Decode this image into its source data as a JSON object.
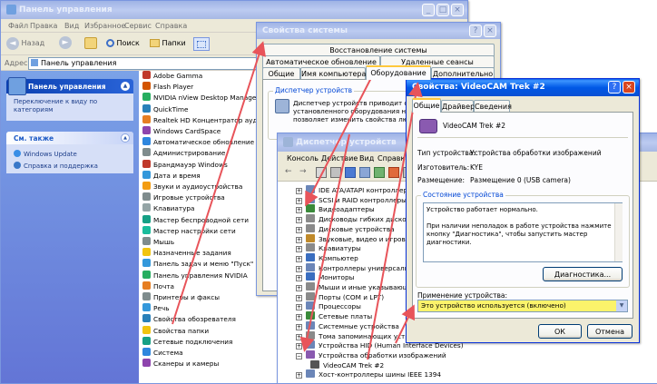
{
  "control_panel": {
    "title": "Панель управления",
    "menu": [
      "Файл",
      "Правка",
      "Вид",
      "Избранное",
      "Сервис",
      "Справка"
    ],
    "toolbar": {
      "back": "Назад",
      "search": "Поиск",
      "folders": "Папки"
    },
    "address_label": "Адрес:",
    "address_value": "Панель управления",
    "sidebar": {
      "panel_title": "Панель управления",
      "switch_view": "Переключение к виду по категориям",
      "see_also_title": "См. также",
      "see_also": [
        "Windows Update",
        "Справка и поддержка"
      ]
    },
    "items": [
      "Adobe Gamma",
      "Flash Player",
      "NVIDIA nView Desktop Manager",
      "QuickTime",
      "Realtek HD Концентратор аудио",
      "Windows CardSpace",
      "Автоматическое обновление",
      "Администрирование",
      "Брандмауэр Windows",
      "Дата и время",
      "Звуки и аудиоустройства",
      "Игровые устройства",
      "Клавиатура",
      "Мастер беспроводной сети",
      "Мастер настройки сети",
      "Мышь",
      "Назначенные задания",
      "Панель задач и меню \"Пуск\"",
      "Панель управления NVIDIA",
      "Почта",
      "Принтеры и факсы",
      "Речь",
      "Свойства обозревателя",
      "Свойства папки",
      "Сетевые подключения",
      "Система",
      "Сканеры и камеры"
    ]
  },
  "system_props": {
    "title": "Свойства системы",
    "tabs_row1": [
      "Восстановление системы"
    ],
    "tabs_row2": [
      "Автоматическое обновление",
      "Удаленные сеансы"
    ],
    "tabs_row3": [
      "Общие",
      "Имя компьютера",
      "Оборудование",
      "Дополнительно"
    ],
    "group_title": "Диспетчер устройств",
    "desc": [
      "Диспетчер устройств приводит спи",
      "установленного оборудования на",
      "позволяет изменить свойства лю"
    ]
  },
  "device_manager": {
    "title": "Диспетчер устройств",
    "menu": [
      "Консоль",
      "Действие",
      "Вид",
      "Справка"
    ],
    "items": [
      {
        "text": "IDE ATA/ATAPI контроллеры",
        "indent": 0,
        "color": "#6b86b8"
      },
      {
        "text": "SCSI и RAID контроллеры",
        "indent": 0,
        "color": "#6b86b8"
      },
      {
        "text": "Видеоадаптеры",
        "indent": 0,
        "color": "#3a8a3a"
      },
      {
        "text": "Дисководы гибких дисков",
        "indent": 0,
        "color": "#8a8a8a"
      },
      {
        "text": "Дисковые устройства",
        "indent": 0,
        "color": "#8a8a8a"
      },
      {
        "text": "Звуковые, видео и игровые устройства",
        "indent": 0,
        "color": "#c08a2a"
      },
      {
        "text": "Клавиатуры",
        "indent": 0,
        "color": "#8a8a8a"
      },
      {
        "text": "Компьютер",
        "indent": 0,
        "color": "#3a6ec0"
      },
      {
        "text": "Контроллеры универсальной последовательной шины USB",
        "indent": 0,
        "color": "#6b86b8"
      },
      {
        "text": "Мониторы",
        "indent": 0,
        "color": "#3a6ec0"
      },
      {
        "text": "Мыши и иные указывающие устройства",
        "indent": 0,
        "color": "#8a8a8a"
      },
      {
        "text": "Порты (COM и LPT)",
        "indent": 0,
        "color": "#8a8a8a"
      },
      {
        "text": "Процессоры",
        "indent": 0,
        "color": "#6b86b8"
      },
      {
        "text": "Сетевые платы",
        "indent": 0,
        "color": "#3a8a3a"
      },
      {
        "text": "Системные устройства",
        "indent": 0,
        "color": "#6b86b8"
      },
      {
        "text": "Тома запоминающих устройств",
        "indent": 0,
        "color": "#8a8a8a"
      },
      {
        "text": "Устройства HID (Human Interface Devices)",
        "indent": 0,
        "color": "#6b86b8"
      },
      {
        "text": "Устройства обработки изображений",
        "indent": 0,
        "color": "#8a5ab0",
        "expanded": true
      },
      {
        "text": "VideoCAM Trek #2",
        "indent": 1,
        "color": "#555555"
      },
      {
        "text": "Хост-контроллеры шины IEEE 1394",
        "indent": 0,
        "color": "#6b86b8"
      }
    ]
  },
  "device_props": {
    "title": "Свойства: VideoCAM Trek #2",
    "tabs": [
      "Общие",
      "Драйвер",
      "Сведения"
    ],
    "device_name": "VideoCAM Trek #2",
    "fields": [
      {
        "label": "Тип устройства:",
        "value": "Устройства обработки изображений"
      },
      {
        "label": "Изготовитель:",
        "value": "KYE"
      },
      {
        "label": "Размещение:",
        "value": "Размещение 0 (USB camera)"
      }
    ],
    "status_title": "Состояние устройства",
    "status_text": [
      "Устройство работает нормально.",
      "",
      "При наличии неполадок в работе устройства нажмите",
      "кнопку \"Диагностика\", чтобы запустить мастер",
      "диагностики."
    ],
    "diag_button": "Диагностика...",
    "usage_label": "Применение устройства:",
    "usage_value": "Это устройство используется (включено)",
    "ok_button": "ОК",
    "cancel_button": "Отмена"
  }
}
